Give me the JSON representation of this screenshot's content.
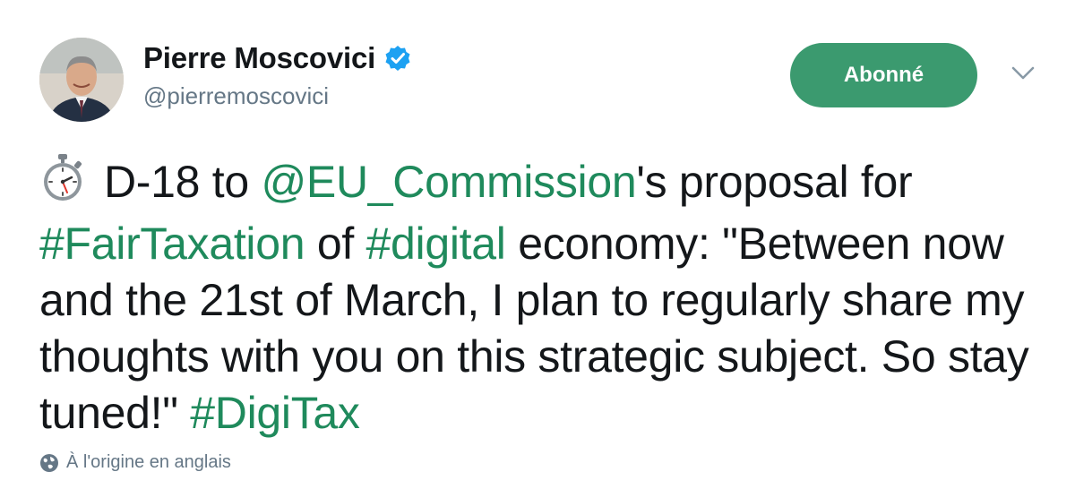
{
  "author": {
    "display_name": "Pierre Moscovici",
    "handle": "@pierremoscovici",
    "verified": true
  },
  "follow_button": {
    "label": "Abonné",
    "color": "#3b9a6f"
  },
  "more_menu": {
    "icon": "chevron-down-icon"
  },
  "tweet": {
    "emoji": "stopwatch-icon",
    "segments": [
      {
        "text": "D-18 to ",
        "type": "text"
      },
      {
        "text": "@EU_Commission",
        "type": "mention"
      },
      {
        "text": "'s proposal for ",
        "type": "text"
      },
      {
        "text": "#FairTaxation",
        "type": "hashtag"
      },
      {
        "text": " of ",
        "type": "text"
      },
      {
        "text": "#digital",
        "type": "hashtag"
      },
      {
        "text": " economy: \"Between now and the 21st of March, I plan to regularly share my thoughts with you on this strategic subject. So stay tuned!\" ",
        "type": "text"
      },
      {
        "text": "#DigiTax",
        "type": "hashtag"
      }
    ],
    "link_color": "#1f8a5c"
  },
  "translation": {
    "label": "À l'origine en anglais",
    "icon": "globe-icon"
  }
}
